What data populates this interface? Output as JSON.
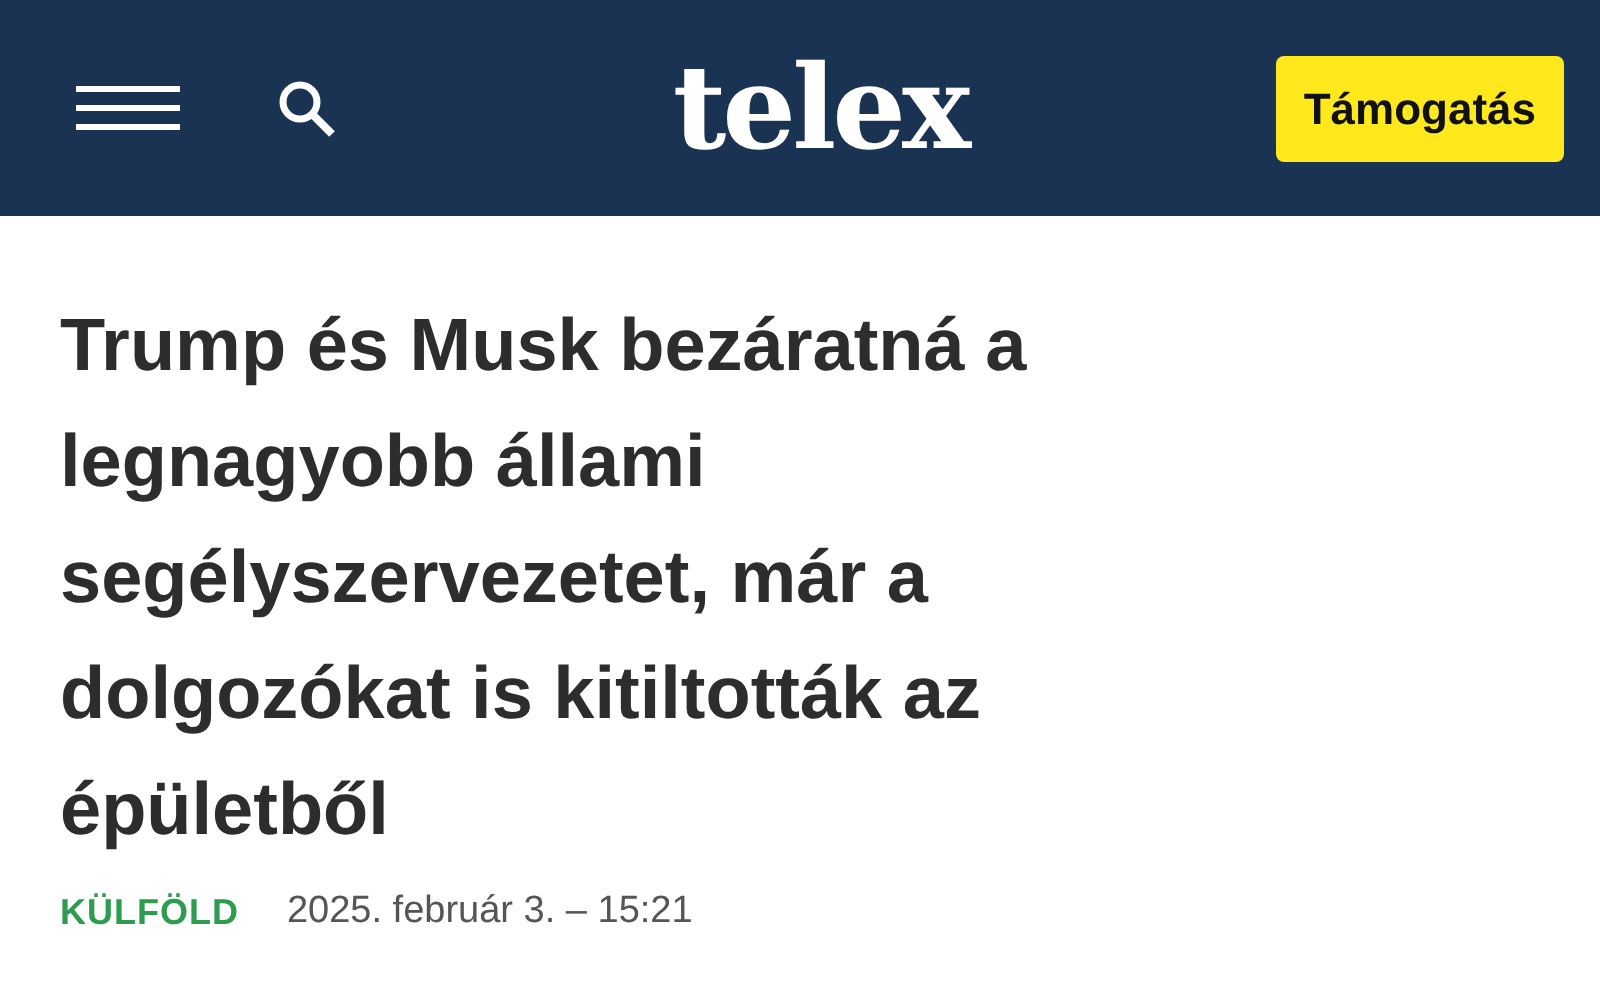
{
  "header": {
    "logo": "telex",
    "support_button": "Támogatás"
  },
  "article": {
    "headline": "Trump és Musk bezáratná a legnagyobb állami segélyszervezetet, már a dolgozókat is kitiltották az épületből",
    "category": "KÜLFÖLD",
    "date": "2025. február 3. – 15:21"
  }
}
